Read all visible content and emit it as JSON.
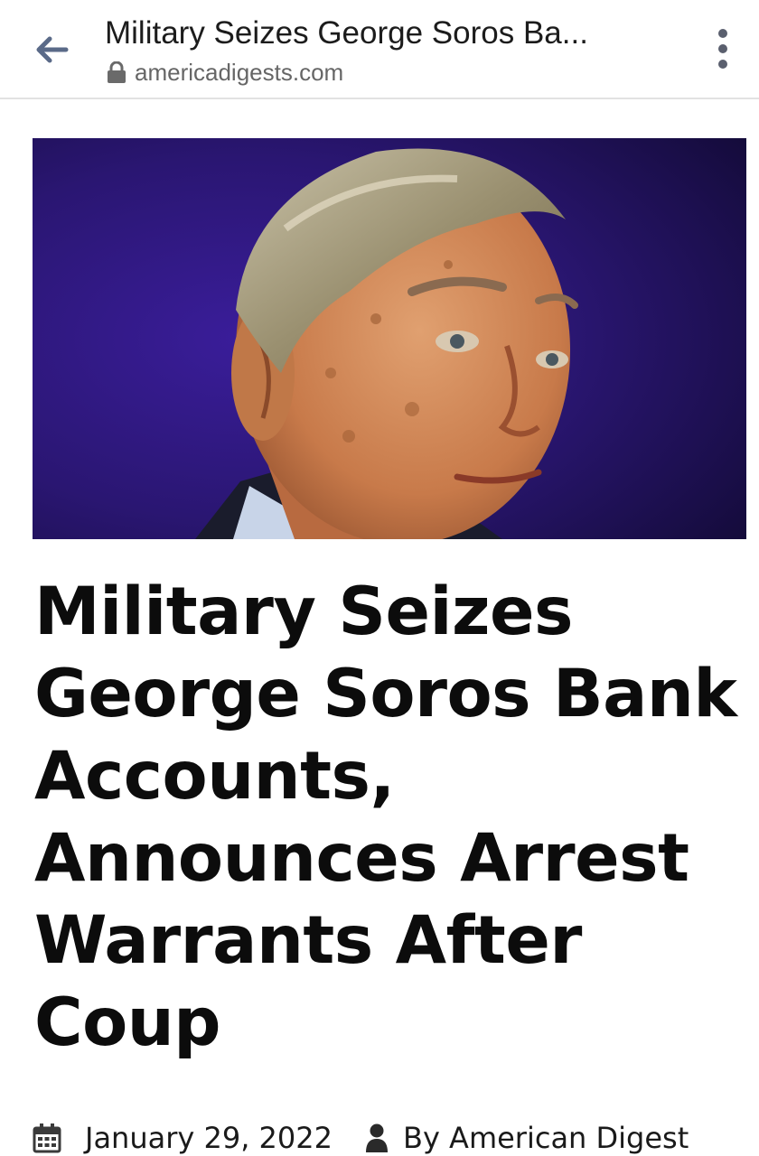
{
  "browser": {
    "tab_title": "Military Seizes George Soros Ba...",
    "url": "americadigests.com",
    "icons": {
      "back": "arrow-left-icon",
      "secure": "lock-icon",
      "menu": "more-vert-icon"
    }
  },
  "article": {
    "headline": "Military Seizes George Soros Bank Accounts, Announces Arrest Warrants After Coup",
    "date": "January 29, 2022",
    "author": "By American Digest",
    "image_subject": "portrait photo on dark purple-blue background",
    "icons": {
      "date": "calendar-icon",
      "author": "user-icon"
    }
  },
  "colors": {
    "back_arrow": "#5a6a88",
    "title_text": "#1c1c1c",
    "url_text": "#666666",
    "headline_text": "#0c0c0c",
    "hero_background": "#2a1a6e"
  }
}
